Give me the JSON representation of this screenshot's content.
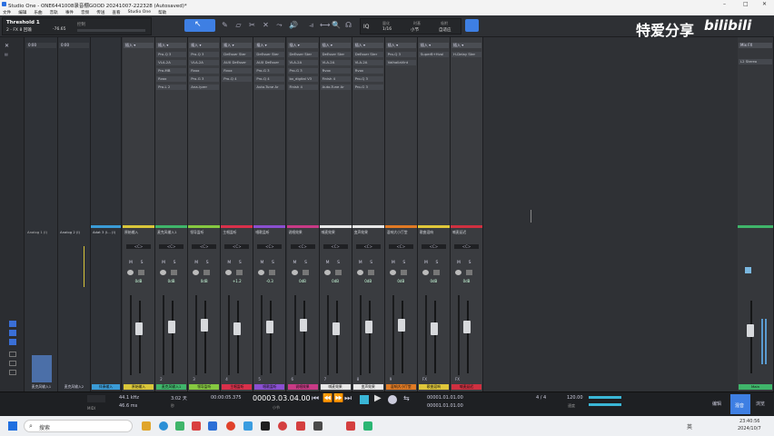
{
  "window": {
    "title": "Studio One - ONE6441008录音棚GOOD 20241007-222328 (Autosaved)*",
    "min_label": "–",
    "max_label": "□",
    "close_label": "✕"
  },
  "menu": [
    "文件",
    "编辑",
    "乐曲",
    "音轨",
    "事件",
    "音频",
    "传送",
    "查看",
    "Studio One",
    "帮助"
  ],
  "toolbar": {
    "preset": "Threshold 1",
    "track_label": "2 - FX 8 回输",
    "control_label": "控制",
    "control_value": "-76.65",
    "snap": "IQ",
    "quantize": "1/16",
    "quantize_label": "量化",
    "timebase": "小节",
    "timebase_label": "时基",
    "snap_mode": "自适应",
    "snap_mode_label": "吸附"
  },
  "watermark": {
    "text": "特爱分享",
    "logo": "bilibili"
  },
  "channels": [
    {
      "name": "原始输入",
      "number": "",
      "color": "#d9c63a",
      "inserts": [],
      "pan": "<C>",
      "volume": "0dB"
    },
    {
      "name": "麦克风输入1",
      "number": "2",
      "color": "#3fb56a",
      "inserts": [
        "Pro-Q 3",
        "VLA-2A",
        "Pro-MB",
        "Rvox",
        "Pro-L 2"
      ],
      "pan": "<C>",
      "volume": "0dB"
    },
    {
      "name": "领导监听",
      "number": "3",
      "color": "#86c940",
      "inserts": [
        "Pro-Q 3",
        "VLA-2A",
        "Rvox",
        "Pro-G 3",
        "Ana-lyzer"
      ],
      "pan": "<C>",
      "volume": "0dB"
    },
    {
      "name": "主唱监听",
      "number": "4",
      "color": "#d9304a",
      "inserts": [
        "DeEsser Ster",
        "AUX DeEsser",
        "Rvox",
        "Pro-Q 4"
      ],
      "pan": "<C>",
      "volume": "+1.2"
    },
    {
      "name": "唱歌监听",
      "number": "5",
      "color": "#8a4fd1",
      "inserts": [
        "DeEsser Ster",
        "AUX DeEsser",
        "Pro-G 3",
        "Pro-Q 4",
        "Auto-Tune Ar"
      ],
      "pan": "<C>",
      "volume": "-0.3"
    },
    {
      "name": "说唱效果",
      "number": "6",
      "color": "#c83a86",
      "inserts": [
        "DeEsser Ster",
        "VLA-2A",
        "Pro-G 3",
        "bx_digital V3",
        "Finish 4"
      ],
      "pan": "<C>",
      "volume": "0dB"
    },
    {
      "name": "喊麦效果",
      "number": "7",
      "color": "#e8e8e8",
      "inserts": [
        "DeEsser Ster",
        "VLA-2A",
        "Rvox",
        "Finish 4",
        "Auto-Tune Ar"
      ],
      "pan": "<C>",
      "volume": "0dB"
    },
    {
      "name": "变声效果",
      "number": "8",
      "color": "#e8e8e8",
      "inserts": [
        "DeEsser Ster",
        "VLA-2A",
        "Rvox",
        "Pro-Q 3",
        "Pro-G 3"
      ],
      "pan": "<C>",
      "volume": "0dB"
    },
    {
      "name": "混响大小厅堂",
      "number": "9",
      "color": "#e07a24",
      "inserts": [
        "Pro-Q 3",
        "ValhallaVint"
      ],
      "pan": "<C>",
      "volume": "0dB"
    },
    {
      "name": "歌曲混响",
      "number": "FX",
      "color": "#e0c73a",
      "inserts": [
        "SuperB+Hvol"
      ],
      "pan": "<C>",
      "volume": "0dB"
    },
    {
      "name": "喊麦延迟",
      "number": "FX",
      "color": "#cf3040",
      "inserts": [
        "H-Delay Ster"
      ],
      "pan": "<C>",
      "volume": "0dB"
    }
  ],
  "inputs": [
    {
      "name": "Analog 1 (I)",
      "label": "麦克风输入1"
    },
    {
      "name": "Analog 2 (I)",
      "label": "麦克风输入2"
    },
    {
      "name": "Adat 3 (I... (I)",
      "label": "伴奏输入"
    }
  ],
  "main": {
    "name": "Main",
    "label": "Mix FX",
    "insert": "L2 Stereo"
  },
  "transport": {
    "sample_rate": "44.1 kHz",
    "sample_rate_label": "MIDI",
    "latency": "46.6 ms",
    "time": "3:02 天",
    "time_label": "秒",
    "position_secondary": "00:00:05.375",
    "position_main": "00003.03.04.00",
    "position_main_label": "小节",
    "loop_start": "00001.01.01.00",
    "loop_end": "00001.01.01.00",
    "signature": "4 / 4",
    "tempo": "120.00",
    "tempo_label": "速度",
    "edit_label": "编辑",
    "mix_label": "混音",
    "browse_label": "浏览"
  },
  "taskbar": {
    "search": "搜索",
    "time": "23:40:56",
    "date": "2024/10/7",
    "lang": "英"
  }
}
